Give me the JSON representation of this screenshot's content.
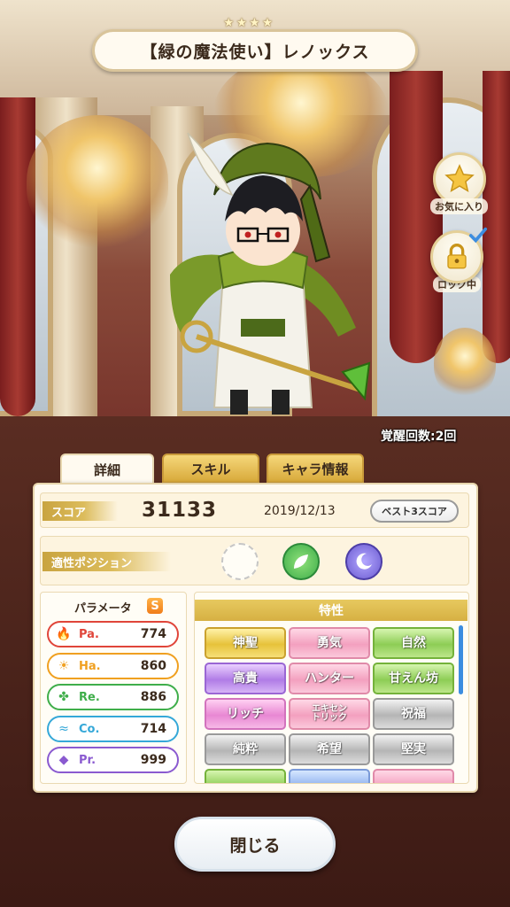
{
  "header": {
    "stars": [
      "★",
      "★",
      "★",
      "★"
    ],
    "character_name": "【緑の魔法使い】レノックス"
  },
  "side_buttons": {
    "favorite_label": "お気に入り",
    "lock_label": "ロック中"
  },
  "awakening": "覚醒回数:2回",
  "tabs": [
    {
      "label": "詳細",
      "active": true
    },
    {
      "label": "スキル",
      "active": false
    },
    {
      "label": "キャラ情報",
      "active": false
    }
  ],
  "score": {
    "label": "スコア",
    "value": "31133",
    "date": "2019/12/13",
    "best_button": "ベスト3スコア"
  },
  "position": {
    "label": "適性ポジション",
    "icons": [
      "empty-position-icon",
      "leaf-position-icon",
      "moon-position-icon"
    ]
  },
  "parameters": {
    "title": "パラメータ",
    "rank": "S",
    "items": [
      {
        "name": "Pa.",
        "value": "774",
        "color": "#e0453a",
        "icon": "flame-icon"
      },
      {
        "name": "Ha.",
        "value": "860",
        "color": "#f0a020",
        "icon": "sun-icon"
      },
      {
        "name": "Re.",
        "value": "886",
        "color": "#3fae4a",
        "icon": "clover-icon"
      },
      {
        "name": "Co.",
        "value": "714",
        "color": "#35a8d8",
        "icon": "wind-icon"
      },
      {
        "name": "Pr.",
        "value": "999",
        "color": "#8a5ad0",
        "icon": "diamond-icon"
      }
    ]
  },
  "traits": {
    "title": "特性",
    "items": [
      {
        "label": "神聖",
        "style": "gold"
      },
      {
        "label": "勇気",
        "style": "pink"
      },
      {
        "label": "自然",
        "style": "green"
      },
      {
        "label": "高貴",
        "style": "purple"
      },
      {
        "label": "ハンター",
        "style": "pink"
      },
      {
        "label": "甘えん坊",
        "style": "green"
      },
      {
        "label": "リッチ",
        "style": "magenta"
      },
      {
        "label": "エキセントリック",
        "style": "pink"
      },
      {
        "label": "祝福",
        "style": "silver"
      },
      {
        "label": "純粋",
        "style": "silver"
      },
      {
        "label": "希望",
        "style": "silver"
      },
      {
        "label": "堅実",
        "style": "silver"
      }
    ]
  },
  "close_button": "閉じる"
}
